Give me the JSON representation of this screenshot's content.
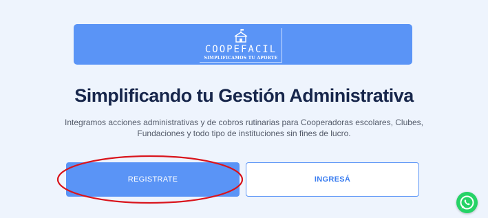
{
  "brand": {
    "name": "COOPEFACIL",
    "tagline": "SIMPLIFICAMOS TU APORTE"
  },
  "hero": {
    "title": "Simplificando tu Gestión Administrativa",
    "subtitle_line1": "Integramos acciones administrativas y de cobros rutinarias para Cooperadoras escolares, Clubes,",
    "subtitle_line2": "Fundaciones y todo tipo de instituciones sin fines de lucro."
  },
  "actions": {
    "register_label": "REGISTRATE",
    "login_label": "INGRESÁ"
  },
  "annotation": {
    "color": "#d9141c"
  },
  "icons": {
    "logo": "school-house-icon",
    "chat": "whatsapp-icon"
  },
  "colors": {
    "accent": "#5a94f6",
    "background": "#eef4fd",
    "heading": "#17264b",
    "whatsapp": "#25d366"
  }
}
